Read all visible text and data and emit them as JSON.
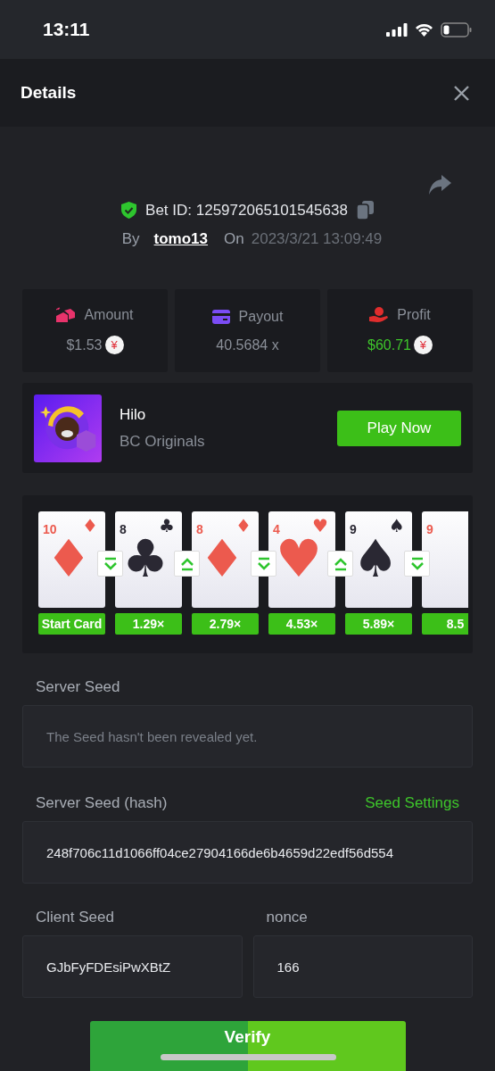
{
  "status_bar": {
    "time": "13:11"
  },
  "header": {
    "title": "Details"
  },
  "bet": {
    "id_label": "Bet ID: 125972065101545638",
    "by_label": "By",
    "user": "tomo13",
    "on_label": "On",
    "date": "2023/3/21 13:09:49"
  },
  "stats": [
    {
      "kind": "amount",
      "label": "Amount",
      "value": "$1.53",
      "currency": "¥",
      "positive": false
    },
    {
      "kind": "payout",
      "label": "Payout",
      "value": "40.5684 x",
      "positive": false
    },
    {
      "kind": "profit",
      "label": "Profit",
      "value": "$60.71",
      "currency": "¥",
      "positive": true
    }
  ],
  "game": {
    "name": "Hilo",
    "provider": "BC Originals",
    "button": "Play Now"
  },
  "cards": [
    {
      "rank": "10",
      "suit": "♦",
      "color": "#ec5a4e",
      "multiplier": "Start Card",
      "higher": false
    },
    {
      "rank": "8",
      "suit": "♣",
      "color": "#2a2833",
      "multiplier": "1.29×",
      "higher": true
    },
    {
      "rank": "8",
      "suit": "♦",
      "color": "#ec5a4e",
      "multiplier": "2.79×",
      "higher": false
    },
    {
      "rank": "4",
      "suit": "♥",
      "color": "#ec5a4e",
      "multiplier": "4.53×",
      "higher": true
    },
    {
      "rank": "9",
      "suit": "♠",
      "color": "#2a2833",
      "multiplier": "5.89×",
      "higher": false
    },
    {
      "rank": "9",
      "color": "#ec5a4e",
      "multiplier": "8.5"
    }
  ],
  "server_seed": {
    "label": "Server Seed",
    "placeholder": "The Seed hasn't been revealed yet."
  },
  "server_hash": {
    "label": "Server Seed (hash)",
    "link": "Seed Settings",
    "value": "248f706c11d1066ff04ce27904166de6b4659d22edf56d554"
  },
  "client_seed": {
    "label": "Client Seed",
    "value": "GJbFyFDEsiPwXBtZ"
  },
  "nonce": {
    "label": "nonce",
    "value": "166"
  },
  "verify_button": "Verify"
}
